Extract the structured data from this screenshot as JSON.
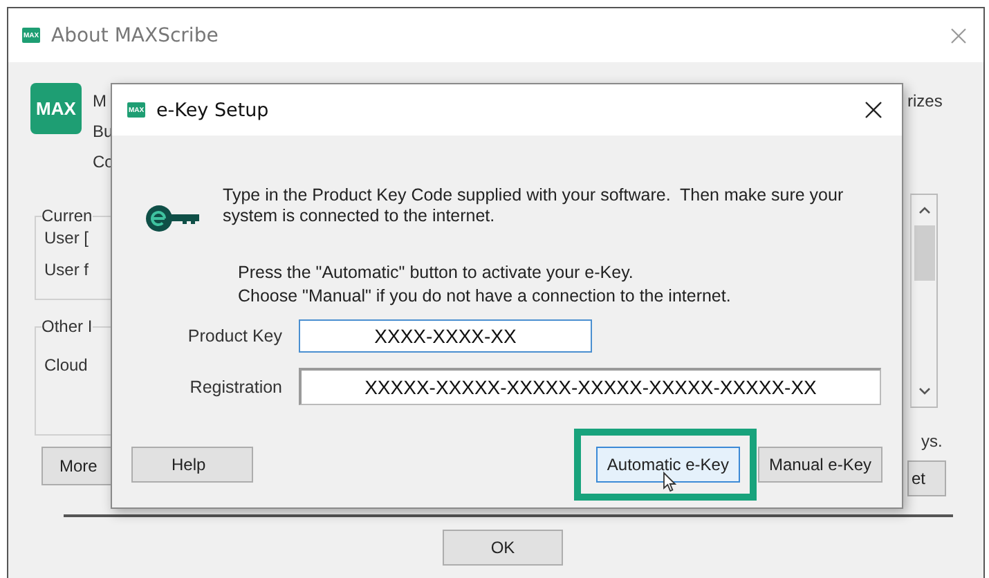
{
  "about_window": {
    "title": "About MAXScribe",
    "icon_text": "MAX"
  },
  "logo": "MAX",
  "header_lines": [
    "M",
    "Bu",
    "Co"
  ],
  "current_group": {
    "label": "Curren",
    "lines": [
      "User [",
      "User f"
    ]
  },
  "other_group": {
    "label": "Other I",
    "lines": [
      "Cloud"
    ]
  },
  "more_button": "More",
  "right_text_top": "rizes",
  "right_text_bottom": "ys.",
  "right_button": "et",
  "ok_button": "OK",
  "dialog": {
    "title": "e-Key Setup",
    "icon_text": "MAX",
    "intro": "Type in the Product Key Code supplied with your software.  Then make sure your system is connected to the internet.",
    "instructions": [
      "Press the \"Automatic\" button to activate your e-Key.",
      "Choose \"Manual\" if you do not have a connection to the internet."
    ],
    "fields": [
      {
        "label": "Product Key",
        "value": "XXXX-XXXX-XX",
        "focused": true
      },
      {
        "label": "Registration",
        "value": "XXXXX-XXXXX-XXXXX-XXXXX-XXXXX-XXXXX-XX",
        "focused": false
      }
    ],
    "buttons": [
      {
        "label": "Help",
        "focused": false,
        "highlighted": false
      },
      {
        "label": "Automatic e-Key",
        "focused": true,
        "highlighted": true
      },
      {
        "label": "Manual e-Key",
        "focused": false,
        "highlighted": false
      }
    ]
  }
}
